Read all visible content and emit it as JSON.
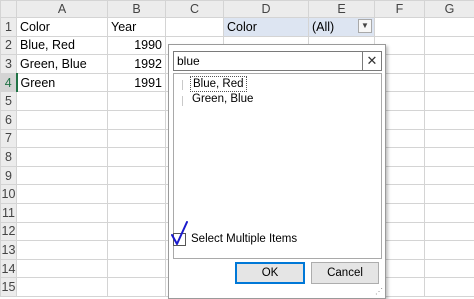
{
  "sheet": {
    "columns": [
      "A",
      "B",
      "C",
      "D",
      "E",
      "F",
      "G"
    ],
    "rows": [
      "1",
      "2",
      "3",
      "4",
      "5",
      "6",
      "7",
      "8",
      "9",
      "10",
      "11",
      "12",
      "13",
      "14",
      "15"
    ],
    "cells": {
      "A1": "Color",
      "B1": "Year",
      "A2": "Blue, Red",
      "B2": "1990",
      "A3": "Green, Blue",
      "B3": "1992",
      "A4": "Green",
      "B4": "1991"
    },
    "pivot": {
      "field_label": "Color",
      "field_value": "(All)",
      "dropdown_icon": "chevron-down-icon"
    },
    "selected_row": "4"
  },
  "filter": {
    "search_value": "blue",
    "clear_icon": "close-icon",
    "items": [
      "Blue, Red",
      "Green, Blue"
    ],
    "select_multiple_label": "Select Multiple Items",
    "select_multiple_checked": true,
    "ok_label": "OK",
    "cancel_label": "Cancel"
  },
  "colors": {
    "accent": "#217346",
    "pivot_fill": "#dde5f2",
    "check_ink": "#1a1acc"
  }
}
